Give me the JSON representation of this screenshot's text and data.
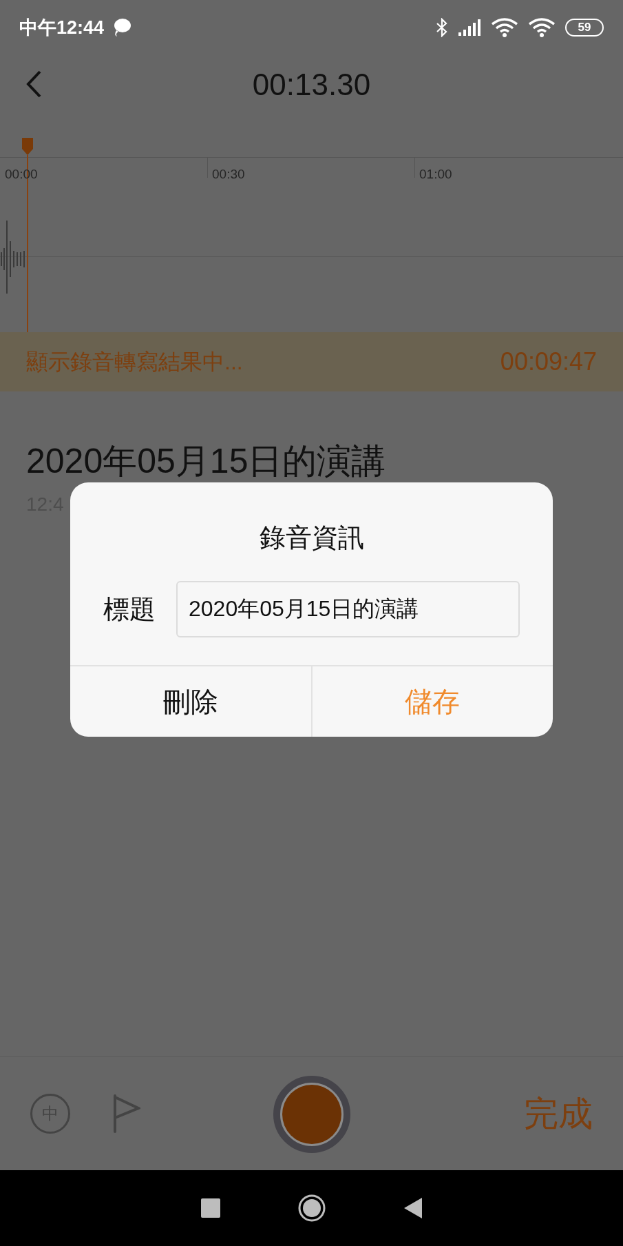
{
  "status_bar": {
    "time": "中午12:44",
    "battery": "59"
  },
  "header": {
    "title": "00:13.30"
  },
  "timeline": {
    "ticks": [
      "00:00",
      "00:30",
      "01:00"
    ]
  },
  "banner": {
    "text": "顯示錄音轉寫結果中...",
    "time": "00:09:47"
  },
  "recording": {
    "title": "2020年05月15日的演講",
    "time": "12:4"
  },
  "dialog": {
    "title": "錄音資訊",
    "field_label": "標題",
    "field_value": "2020年05月15日的演講",
    "buttons": [
      {
        "label": "刪除",
        "kind": "neutral"
      },
      {
        "label": "儲存",
        "kind": "primary"
      }
    ]
  },
  "bottom_bar": {
    "language": "中",
    "done": "完成"
  }
}
